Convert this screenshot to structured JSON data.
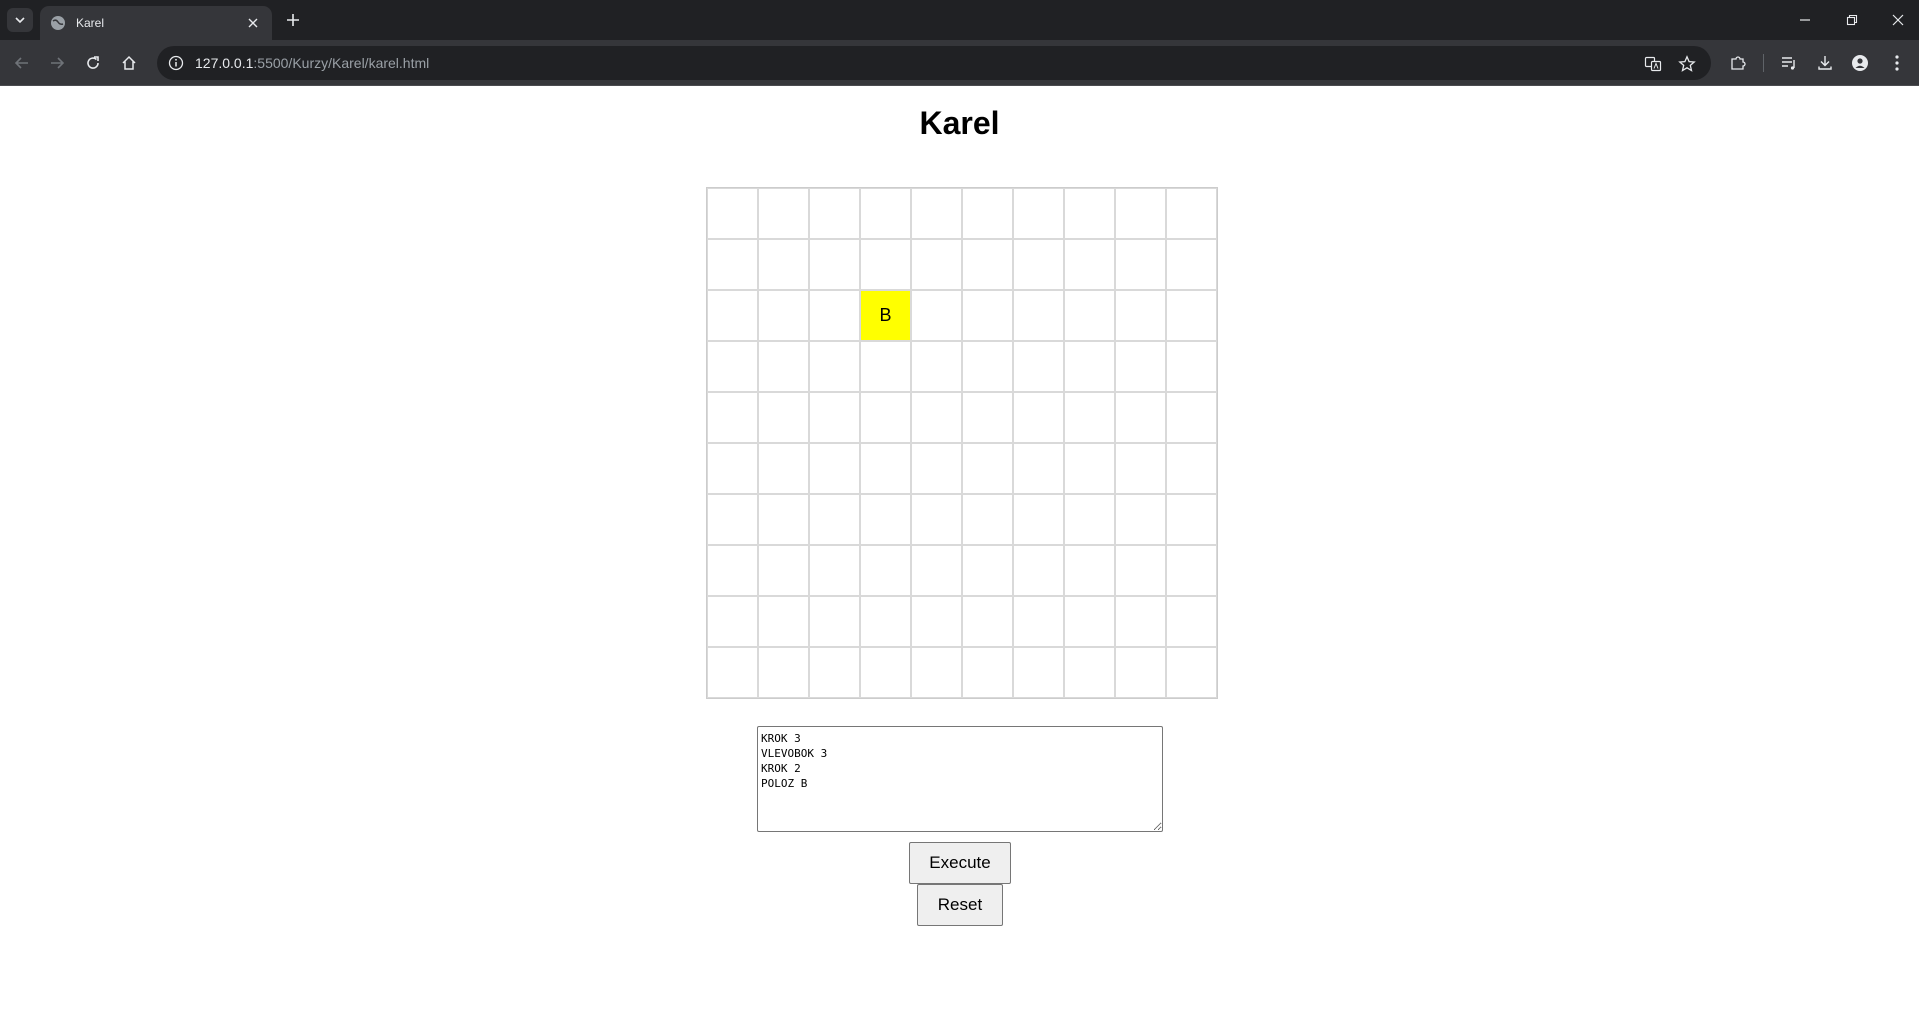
{
  "browser": {
    "tab": {
      "title": "Karel"
    },
    "address": {
      "host": "127.0.0.1",
      "rest": ":5500/Kurzy/Karel/karel.html"
    }
  },
  "page": {
    "title": "Karel",
    "grid": {
      "rows": 10,
      "cols": 10,
      "filled_cells": [
        {
          "row": 3,
          "col": 4,
          "label": "B",
          "color": "#ffff00"
        }
      ]
    },
    "commands": "KROK 3\nVLEVOBOK 3\nKROK 2\nPOLOZ B",
    "execute_label": "Execute",
    "reset_label": "Reset"
  }
}
